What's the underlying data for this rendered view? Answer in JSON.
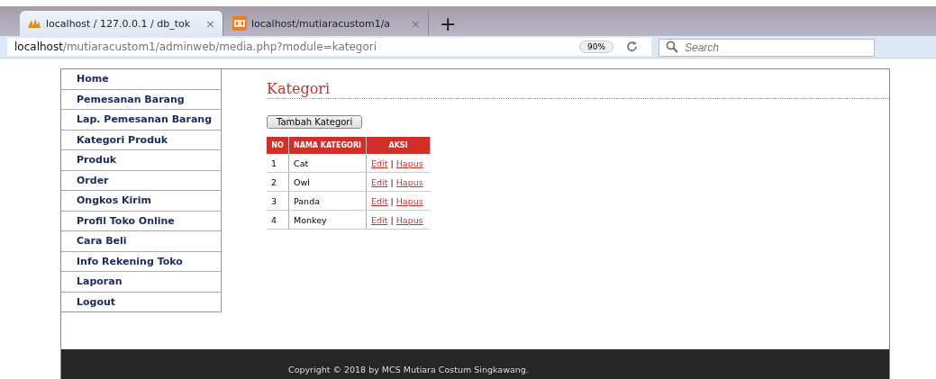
{
  "browser": {
    "tabs": [
      {
        "title": "localhost / 127.0.0.1 / db_tok",
        "selected": true
      },
      {
        "title": "localhost/mutiaracustom1/a",
        "selected": false
      }
    ],
    "new_tab": "+",
    "close_glyph": "×",
    "url": {
      "host": "localhost",
      "path": "/mutiaracustom1/adminweb/media.php?module=kategori"
    },
    "zoom": "90%",
    "search": {
      "placeholder": "Search"
    }
  },
  "sidebar": {
    "items": [
      {
        "label": "Home"
      },
      {
        "label": "Pemesanan Barang"
      },
      {
        "label": "Lap. Pemesanan Barang"
      },
      {
        "label": "Kategori Produk"
      },
      {
        "label": "Produk"
      },
      {
        "label": "Order"
      },
      {
        "label": "Ongkos Kirim"
      },
      {
        "label": "Profil Toko Online"
      },
      {
        "label": "Cara Beli"
      },
      {
        "label": "Info Rekening Toko"
      },
      {
        "label": "Laporan"
      },
      {
        "label": "Logout"
      }
    ]
  },
  "content": {
    "title": "Kategori",
    "add_button": "Tambah Kategori",
    "table": {
      "columns": [
        "NO",
        "NAMA KATEGORI",
        "AKSI"
      ],
      "rows": [
        {
          "no": "1",
          "name": "Cat",
          "edit": "Edit",
          "separator": "|",
          "delete": "Hapus"
        },
        {
          "no": "2",
          "name": "Owl",
          "edit": "Edit",
          "separator": "|",
          "delete": "Hapus"
        },
        {
          "no": "3",
          "name": "Panda",
          "edit": "Edit",
          "separator": "|",
          "delete": "Hapus"
        },
        {
          "no": "4",
          "name": "Monkey",
          "edit": "Edit",
          "separator": "|",
          "delete": "Hapus"
        }
      ]
    }
  },
  "footer": {
    "text": "Copyright © 2018 by MCS Mutiara Costum Singkawang."
  }
}
